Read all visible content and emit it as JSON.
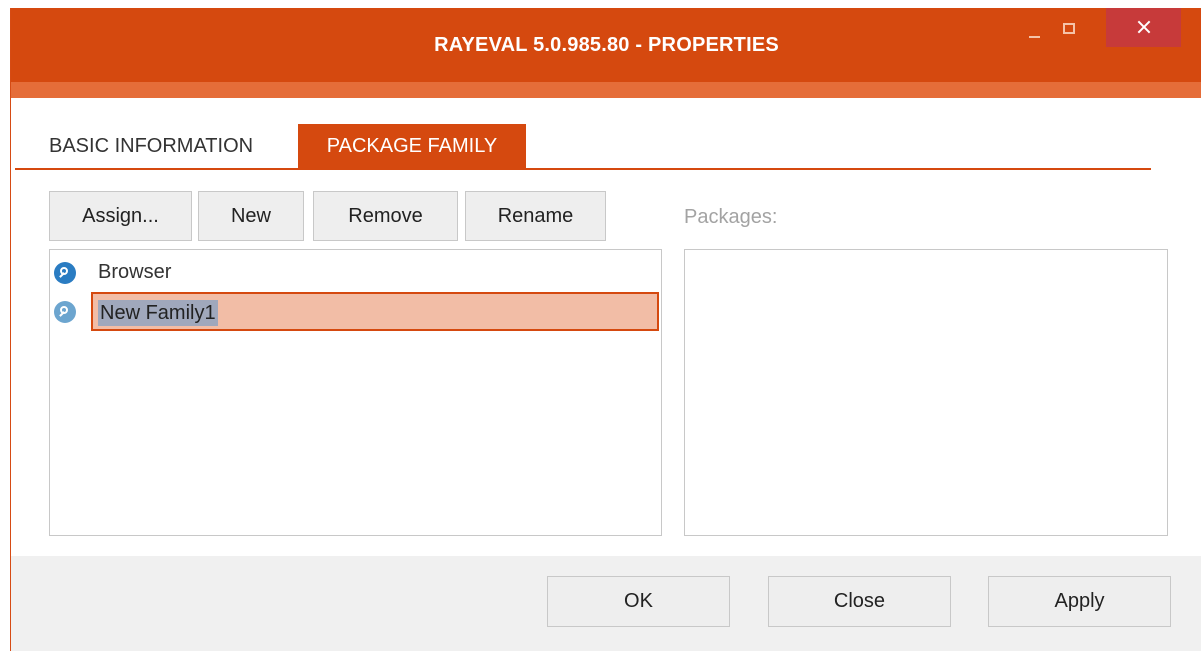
{
  "window": {
    "title": "RAYEVAL 5.0.985.80 - PROPERTIES",
    "controls": [
      "minimize-icon",
      "maximize-icon",
      "close-icon"
    ]
  },
  "tabs": [
    {
      "label": "BASIC INFORMATION",
      "active": false
    },
    {
      "label": "PACKAGE FAMILY",
      "active": true
    }
  ],
  "toolbar": {
    "assign_label": "Assign...",
    "new_label": "New",
    "remove_label": "Remove",
    "rename_label": "Rename"
  },
  "families": [
    {
      "label": "Browser",
      "icon": "family-icon"
    },
    {
      "label": "New Family1",
      "icon": "family-icon",
      "editing": true
    }
  ],
  "packages": {
    "label": "Packages:",
    "items": []
  },
  "footer": {
    "ok_label": "OK",
    "close_label": "Close",
    "apply_label": "Apply"
  },
  "colors": {
    "accent": "#d5490f",
    "accent_light": "#e56d39",
    "selection_fill": "#f2bda6",
    "close_button": "#c73a3a"
  }
}
